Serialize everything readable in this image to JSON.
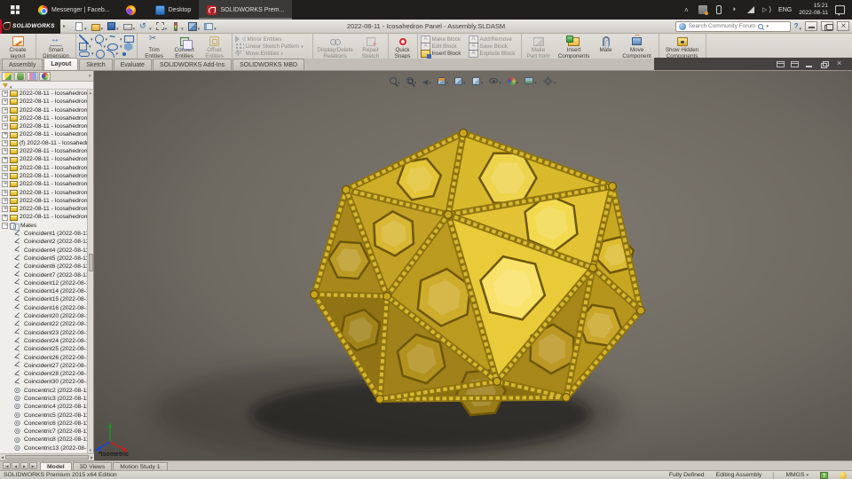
{
  "taskbar": {
    "items": [
      {
        "t": "chrome",
        "l": "Messenger | Faceb..."
      },
      {
        "t": "firefox",
        "l": ""
      },
      {
        "t": "desktop",
        "l": "Desktop"
      },
      {
        "t": "solidworks",
        "l": "SOLIDWORKS Prem...",
        "active": true
      }
    ],
    "tray": {
      "lang": "ENG",
      "time": "15:21",
      "date": "2022-08-11"
    }
  },
  "titlebar": {
    "brand": "SOLIDWORKS",
    "title": "2022-08-11 - Icosahedron Panel - Assembly.SLDASM",
    "search_placeholder": "Search Community Forum"
  },
  "qat": {
    "icons": [
      "new",
      "open",
      "save",
      "print",
      "undo",
      "select",
      "options",
      "rebuild",
      "settings"
    ]
  },
  "ribbon": {
    "create_layout": "Create layout",
    "smart_dimension": "Smart Dimension",
    "trim": "Trim Entities",
    "convert": "Convert Entities",
    "offset": "Offset Entities",
    "mirror": "Mirror Entities",
    "linear_pattern": "Linear Sketch Pattern",
    "move_entities": "Move Entities",
    "display_delete": "Display/Delete Relations",
    "repair_sketch": "Repair Sketch",
    "quick_snaps": "Quick Snaps",
    "make_block": "Make Block",
    "edit_block": "Edit Block",
    "insert_block": "Insert Block",
    "add_remove": "Add/Remove",
    "save_block": "Save Block",
    "explode_block": "Explode Block",
    "make_part": "Make Part from Bl...",
    "insert_components": "Insert Components",
    "mate": "Mate",
    "move_component": "Move Component",
    "show_hidden": "Show Hidden Components"
  },
  "tabs": {
    "items": [
      {
        "l": "Assembly"
      },
      {
        "l": "Layout",
        "active": true
      },
      {
        "l": "Sketch"
      },
      {
        "l": "Evaluate"
      },
      {
        "l": "SOLIDWORKS Add-Ins"
      },
      {
        "l": "SOLIDWORKS MBD"
      }
    ]
  },
  "panel_tabs": {
    "icons": [
      "featuremanager",
      "propertymanager",
      "configurations",
      "displaymanager"
    ],
    "overflow": "»"
  },
  "hud": {
    "icons": [
      "zoom-fit",
      "zoom-to-area",
      "previous-view",
      "section-view",
      "view-orientation",
      "display-style",
      "hide-show-items",
      "edit-appearance",
      "apply-scene",
      "view-settings"
    ]
  },
  "tree": {
    "items": [
      {
        "t": "part",
        "l": "2022-08-11 - Icosahedron Pa"
      },
      {
        "t": "part",
        "l": "2022-08-11 - Icosahedron Pa"
      },
      {
        "t": "part",
        "l": "2022-08-11 - Icosahedron Pa"
      },
      {
        "t": "part",
        "l": "2022-08-11 - Icosahedron Pa"
      },
      {
        "t": "part",
        "l": "2022-08-11 - Icosahedron Pa"
      },
      {
        "t": "part",
        "l": "2022-08-11 - Icosahedron Pa"
      },
      {
        "t": "part",
        "l": "(f) 2022-08-11 - Icosahedron"
      },
      {
        "t": "part",
        "l": "2022-08-11 - Icosahedron Pa"
      },
      {
        "t": "part",
        "l": "2022-08-11 - Icosahedron Pa"
      },
      {
        "t": "part",
        "l": "2022-08-11 - Icosahedron Pa"
      },
      {
        "t": "part",
        "l": "2022-08-11 - Icosahedron Pa"
      },
      {
        "t": "part",
        "l": "2022-08-11 - Icosahedron Pa"
      },
      {
        "t": "part",
        "l": "2022-08-11 - Icosahedron Pa"
      },
      {
        "t": "part",
        "l": "2022-08-11 - Icosahedron Pa"
      },
      {
        "t": "part",
        "l": "2022-08-11 - Icosahedron Pa"
      },
      {
        "t": "part",
        "l": "2022-08-11 - Icosahedron Pa"
      },
      {
        "t": "mates",
        "l": "Mates"
      },
      {
        "t": "coincident",
        "l": "Coincident1 (2022-08-11"
      },
      {
        "t": "coincident",
        "l": "Coincident2 (2022-08-11"
      },
      {
        "t": "coincident",
        "l": "Coincident4 (2022-08-11"
      },
      {
        "t": "coincident",
        "l": "Coincident5 (2022-08-11"
      },
      {
        "t": "coincident",
        "l": "Coincident6 (2022-08-11"
      },
      {
        "t": "coincident",
        "l": "Coincident7 (2022-08-11"
      },
      {
        "t": "coincident",
        "l": "Coincident12 (2022-08-1"
      },
      {
        "t": "coincident",
        "l": "Coincident14 (2022-08-1"
      },
      {
        "t": "coincident",
        "l": "Coincident15 (2022-08-1"
      },
      {
        "t": "coincident",
        "l": "Coincident16 (2022-08-1"
      },
      {
        "t": "coincident",
        "l": "Coincident20 (2022-08-1"
      },
      {
        "t": "coincident",
        "l": "Coincident22 (2022-08-1"
      },
      {
        "t": "coincident",
        "l": "Coincident23 (2022-08-1"
      },
      {
        "t": "coincident",
        "l": "Coincident24 (2022-08-1"
      },
      {
        "t": "coincident",
        "l": "Coincident25 (2022-08-1"
      },
      {
        "t": "coincident",
        "l": "Coincident26 (2022-08-1"
      },
      {
        "t": "coincident",
        "l": "Coincident27 (2022-08-1"
      },
      {
        "t": "coincident",
        "l": "Coincident28 (2022-08-1"
      },
      {
        "t": "coincident",
        "l": "Coincident30 (2022-08-1"
      },
      {
        "t": "concentric",
        "l": "Concentric2 (2022-08-11"
      },
      {
        "t": "concentric",
        "l": "Concentric3 (2022-08-11"
      },
      {
        "t": "concentric",
        "l": "Concentric4 (2022-08-11"
      },
      {
        "t": "concentric",
        "l": "Concentric5 (2022-08-11"
      },
      {
        "t": "concentric",
        "l": "Concentric6 (2022-08-11"
      },
      {
        "t": "concentric",
        "l": "Concentric7 (2022-08-11"
      },
      {
        "t": "concentric",
        "l": "Concentric8 (2022-08-11"
      },
      {
        "t": "concentric",
        "l": "Concentric13 (2022-08-1"
      }
    ]
  },
  "viewport": {
    "view_label": "*Isometric"
  },
  "bottom_tabs": {
    "items": [
      {
        "l": "Model",
        "active": true
      },
      {
        "l": "3D Views"
      },
      {
        "l": "Motion Study 1"
      }
    ]
  },
  "statusbar": {
    "edition": "SOLIDWORKS Premium 2015 x64 Edition",
    "defined": "Fully Defined",
    "mode": "Editing Assembly",
    "units": "MMGS"
  }
}
